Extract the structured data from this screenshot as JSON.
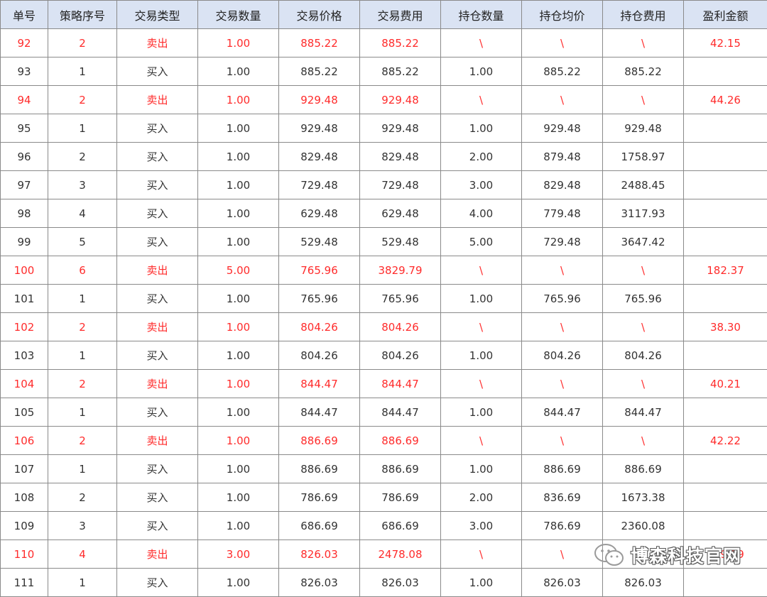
{
  "table": {
    "headers": [
      "单号",
      "策略序号",
      "交易类型",
      "交易数量",
      "交易价格",
      "交易费用",
      "持仓数量",
      "持仓均价",
      "持仓费用",
      "盈利金额"
    ],
    "rows": [
      {
        "type": "sell",
        "cells": [
          "92",
          "2",
          "卖出",
          "1.00",
          "885.22",
          "885.22",
          "\\",
          "\\",
          "\\",
          "42.15"
        ]
      },
      {
        "type": "buy",
        "cells": [
          "93",
          "1",
          "买入",
          "1.00",
          "885.22",
          "885.22",
          "1.00",
          "885.22",
          "885.22",
          ""
        ]
      },
      {
        "type": "sell",
        "cells": [
          "94",
          "2",
          "卖出",
          "1.00",
          "929.48",
          "929.48",
          "\\",
          "\\",
          "\\",
          "44.26"
        ]
      },
      {
        "type": "buy",
        "cells": [
          "95",
          "1",
          "买入",
          "1.00",
          "929.48",
          "929.48",
          "1.00",
          "929.48",
          "929.48",
          ""
        ]
      },
      {
        "type": "buy",
        "cells": [
          "96",
          "2",
          "买入",
          "1.00",
          "829.48",
          "829.48",
          "2.00",
          "879.48",
          "1758.97",
          ""
        ]
      },
      {
        "type": "buy",
        "cells": [
          "97",
          "3",
          "买入",
          "1.00",
          "729.48",
          "729.48",
          "3.00",
          "829.48",
          "2488.45",
          ""
        ]
      },
      {
        "type": "buy",
        "cells": [
          "98",
          "4",
          "买入",
          "1.00",
          "629.48",
          "629.48",
          "4.00",
          "779.48",
          "3117.93",
          ""
        ]
      },
      {
        "type": "buy",
        "cells": [
          "99",
          "5",
          "买入",
          "1.00",
          "529.48",
          "529.48",
          "5.00",
          "729.48",
          "3647.42",
          ""
        ]
      },
      {
        "type": "sell",
        "cells": [
          "100",
          "6",
          "卖出",
          "5.00",
          "765.96",
          "3829.79",
          "\\",
          "\\",
          "\\",
          "182.37"
        ]
      },
      {
        "type": "buy",
        "cells": [
          "101",
          "1",
          "买入",
          "1.00",
          "765.96",
          "765.96",
          "1.00",
          "765.96",
          "765.96",
          ""
        ]
      },
      {
        "type": "sell",
        "cells": [
          "102",
          "2",
          "卖出",
          "1.00",
          "804.26",
          "804.26",
          "\\",
          "\\",
          "\\",
          "38.30"
        ]
      },
      {
        "type": "buy",
        "cells": [
          "103",
          "1",
          "买入",
          "1.00",
          "804.26",
          "804.26",
          "1.00",
          "804.26",
          "804.26",
          ""
        ]
      },
      {
        "type": "sell",
        "cells": [
          "104",
          "2",
          "卖出",
          "1.00",
          "844.47",
          "844.47",
          "\\",
          "\\",
          "\\",
          "40.21"
        ]
      },
      {
        "type": "buy",
        "cells": [
          "105",
          "1",
          "买入",
          "1.00",
          "844.47",
          "844.47",
          "1.00",
          "844.47",
          "844.47",
          ""
        ]
      },
      {
        "type": "sell",
        "cells": [
          "106",
          "2",
          "卖出",
          "1.00",
          "886.69",
          "886.69",
          "\\",
          "\\",
          "\\",
          "42.22"
        ]
      },
      {
        "type": "buy",
        "cells": [
          "107",
          "1",
          "买入",
          "1.00",
          "886.69",
          "886.69",
          "1.00",
          "886.69",
          "886.69",
          ""
        ]
      },
      {
        "type": "buy",
        "cells": [
          "108",
          "2",
          "买入",
          "1.00",
          "786.69",
          "786.69",
          "2.00",
          "836.69",
          "1673.38",
          ""
        ]
      },
      {
        "type": "buy",
        "cells": [
          "109",
          "3",
          "买入",
          "1.00",
          "686.69",
          "686.69",
          "3.00",
          "786.69",
          "2360.08",
          ""
        ]
      },
      {
        "type": "sell",
        "cells": [
          "110",
          "4",
          "卖出",
          "3.00",
          "826.03",
          "2478.08",
          "\\",
          "\\",
          "\\",
          "119.99"
        ]
      },
      {
        "type": "buy",
        "cells": [
          "111",
          "1",
          "买入",
          "1.00",
          "826.03",
          "826.03",
          "1.00",
          "826.03",
          "826.03",
          ""
        ]
      }
    ]
  },
  "watermark": {
    "text": "博森科技官网",
    "icon": "wechat-icon"
  },
  "colors": {
    "header_bg": "#dae3f3",
    "sell_text": "#ff2b2b",
    "buy_text": "#333333",
    "border": "#8a8a8a"
  }
}
